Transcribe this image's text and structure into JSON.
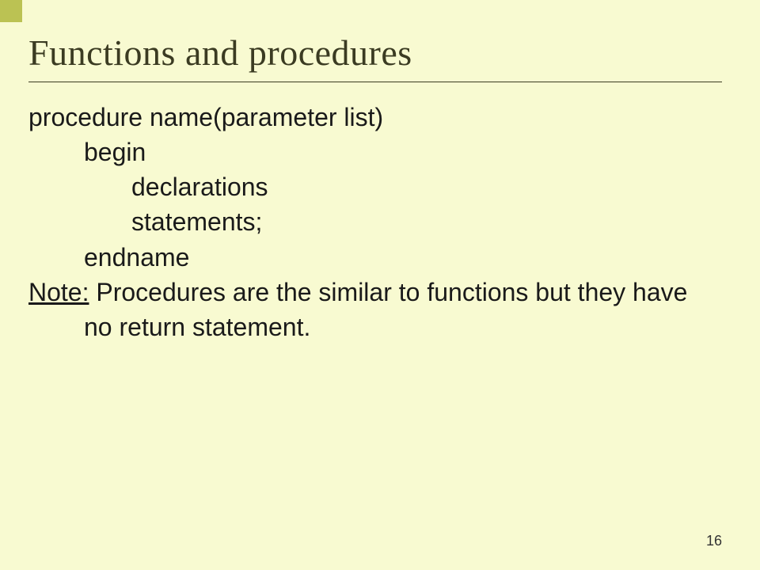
{
  "title": "Functions and procedures",
  "code": {
    "line1": "procedure name(parameter list)",
    "line2": "begin",
    "line3": "declarations",
    "line4": "statements;",
    "line5": "endname"
  },
  "note": {
    "label": "Note:",
    "text": " Procedures are the similar to functions but they have no return statement."
  },
  "page_number": "16"
}
